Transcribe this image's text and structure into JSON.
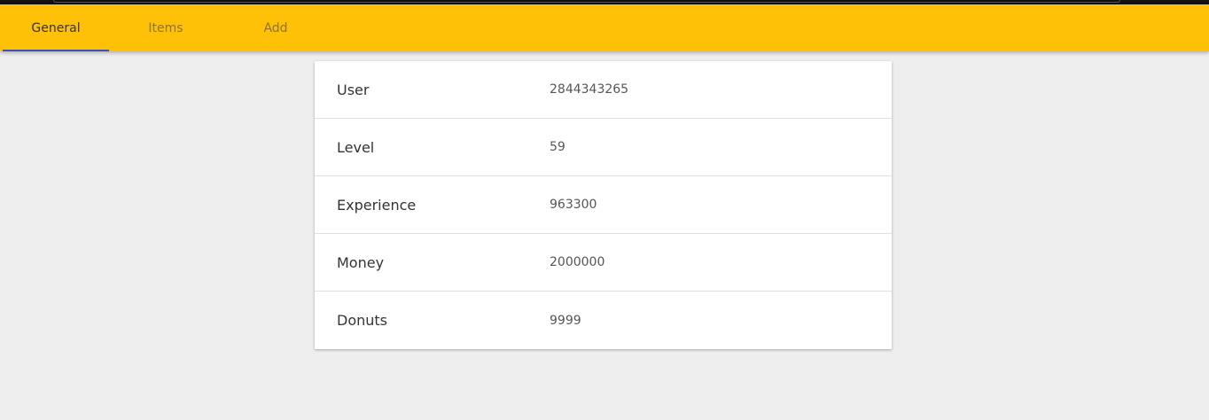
{
  "tabs": [
    {
      "label": "General",
      "active": true
    },
    {
      "label": "Items",
      "active": false
    },
    {
      "label": "Add",
      "active": false
    }
  ],
  "colors": {
    "toolbar": "#ffc107",
    "active_indicator": "#3f51b5",
    "background": "#eeeeee"
  },
  "rows": [
    {
      "label": "User",
      "value": "2844343265"
    },
    {
      "label": "Level",
      "value": "59"
    },
    {
      "label": "Experience",
      "value": "963300"
    },
    {
      "label": "Money",
      "value": "2000000"
    },
    {
      "label": "Donuts",
      "value": "9999"
    }
  ]
}
